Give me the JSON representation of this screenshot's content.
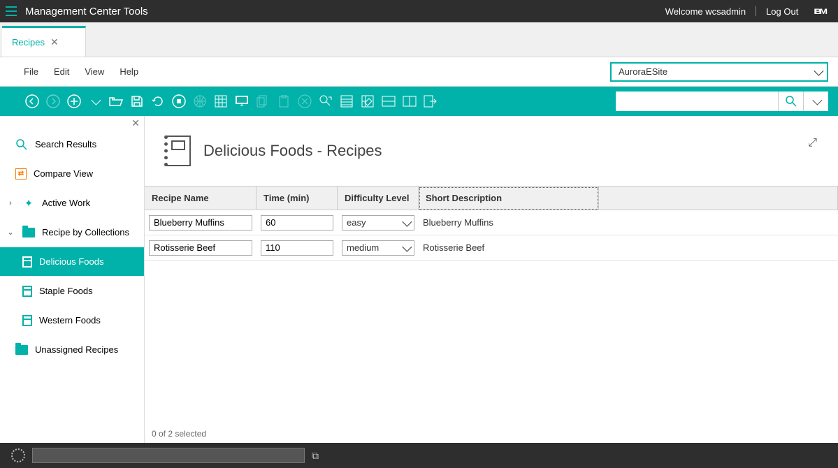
{
  "header": {
    "app_title": "Management Center Tools",
    "welcome": "Welcome wcsadmin",
    "logout": "Log Out",
    "logo": "IBM"
  },
  "tab": {
    "label": "Recipes"
  },
  "menus": {
    "file": "File",
    "edit": "Edit",
    "view": "View",
    "help": "Help"
  },
  "site_selector": {
    "value": "AuroraESite"
  },
  "nav": {
    "search_results": "Search Results",
    "compare_view": "Compare View",
    "active_work": "Active Work",
    "recipe_by_collections": "Recipe by Collections",
    "delicious_foods": "Delicious Foods",
    "staple_foods": "Staple Foods",
    "western_foods": "Western Foods",
    "unassigned_recipes": "Unassigned Recipes"
  },
  "page": {
    "title": "Delicious Foods - Recipes"
  },
  "table": {
    "headers": {
      "name": "Recipe Name",
      "time": "Time (min)",
      "difficulty": "Difficulty Level",
      "desc": "Short Description"
    },
    "rows": [
      {
        "name": "Blueberry Muffins",
        "time": "60",
        "difficulty": "easy",
        "desc": "Blueberry Muffins"
      },
      {
        "name": "Rotisserie Beef",
        "time": "110",
        "difficulty": "medium",
        "desc": "Rotisserie Beef"
      }
    ],
    "status": "0 of 2 selected"
  }
}
